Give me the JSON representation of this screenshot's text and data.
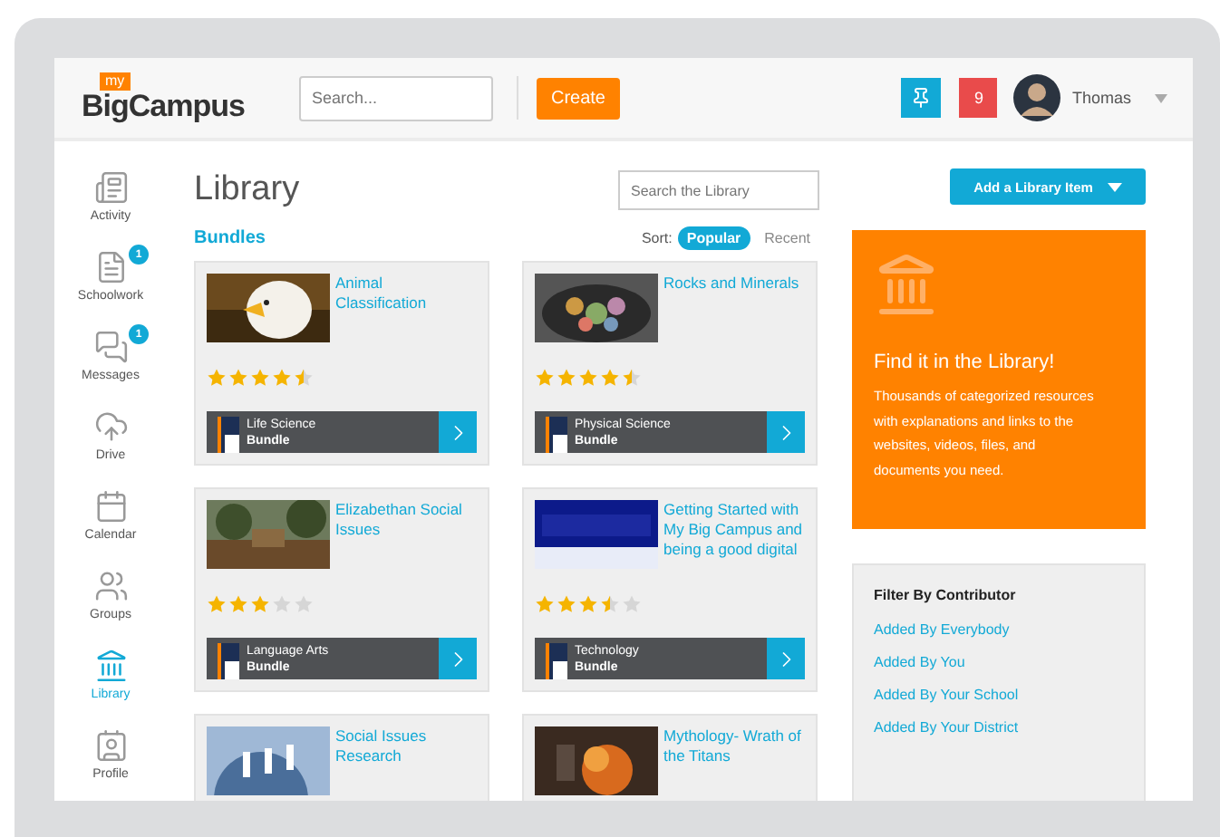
{
  "header": {
    "logo_badge": "my",
    "logo": "BigCampus",
    "search": {
      "placeholder": "Search..."
    },
    "create_button": "Create",
    "notifications": "9",
    "user": "Thomas"
  },
  "sidebar": {
    "items": [
      {
        "label": "Activity",
        "selected": false
      },
      {
        "label": "Schoolwork",
        "badge": "1",
        "selected": false
      },
      {
        "label": "Messages",
        "badge": "1",
        "selected": false
      },
      {
        "label": "Drive",
        "selected": false
      },
      {
        "label": "Calendar",
        "selected": false
      },
      {
        "label": "Groups",
        "selected": false
      },
      {
        "label": "Library",
        "selected": true
      },
      {
        "label": "Profile",
        "selected": false
      }
    ]
  },
  "main": {
    "title": "Library",
    "search": {
      "placeholder": "Search the Library"
    },
    "section": "Bundles",
    "sort_label": "Sort:",
    "sort_options": [
      {
        "label": "Popular",
        "selected": true
      },
      {
        "label": "Recent",
        "selected": false
      }
    ],
    "cards": [
      {
        "title": "Animal Classification",
        "stars": 4.5,
        "subject": "Life Science",
        "type": "Bundle"
      },
      {
        "title": "Rocks and Minerals",
        "stars": 4.5,
        "subject": "Physical Science",
        "type": "Bundle"
      },
      {
        "title": "Elizabethan Social Issues",
        "stars": 3,
        "subject": "Language Arts",
        "type": "Bundle"
      },
      {
        "title": "Getting Started with My Big Campus and being a good digital",
        "stars": 3.5,
        "subject": "Technology",
        "type": "Bundle"
      },
      {
        "title": "Social Issues Research"
      },
      {
        "title": "Mythology- Wrath of the Titans"
      }
    ]
  },
  "aside": {
    "add_button": "Add a Library Item",
    "promo": {
      "title": "Find it in the Library!",
      "text": "Thousands of categorized resources with explanations and links to the websites, videos, files, and documents you need."
    },
    "filter": {
      "title": "Filter By Contributor",
      "links": [
        "Added By Everybody",
        "Added By You",
        "Added By Your School",
        "Added By Your District"
      ]
    }
  }
}
